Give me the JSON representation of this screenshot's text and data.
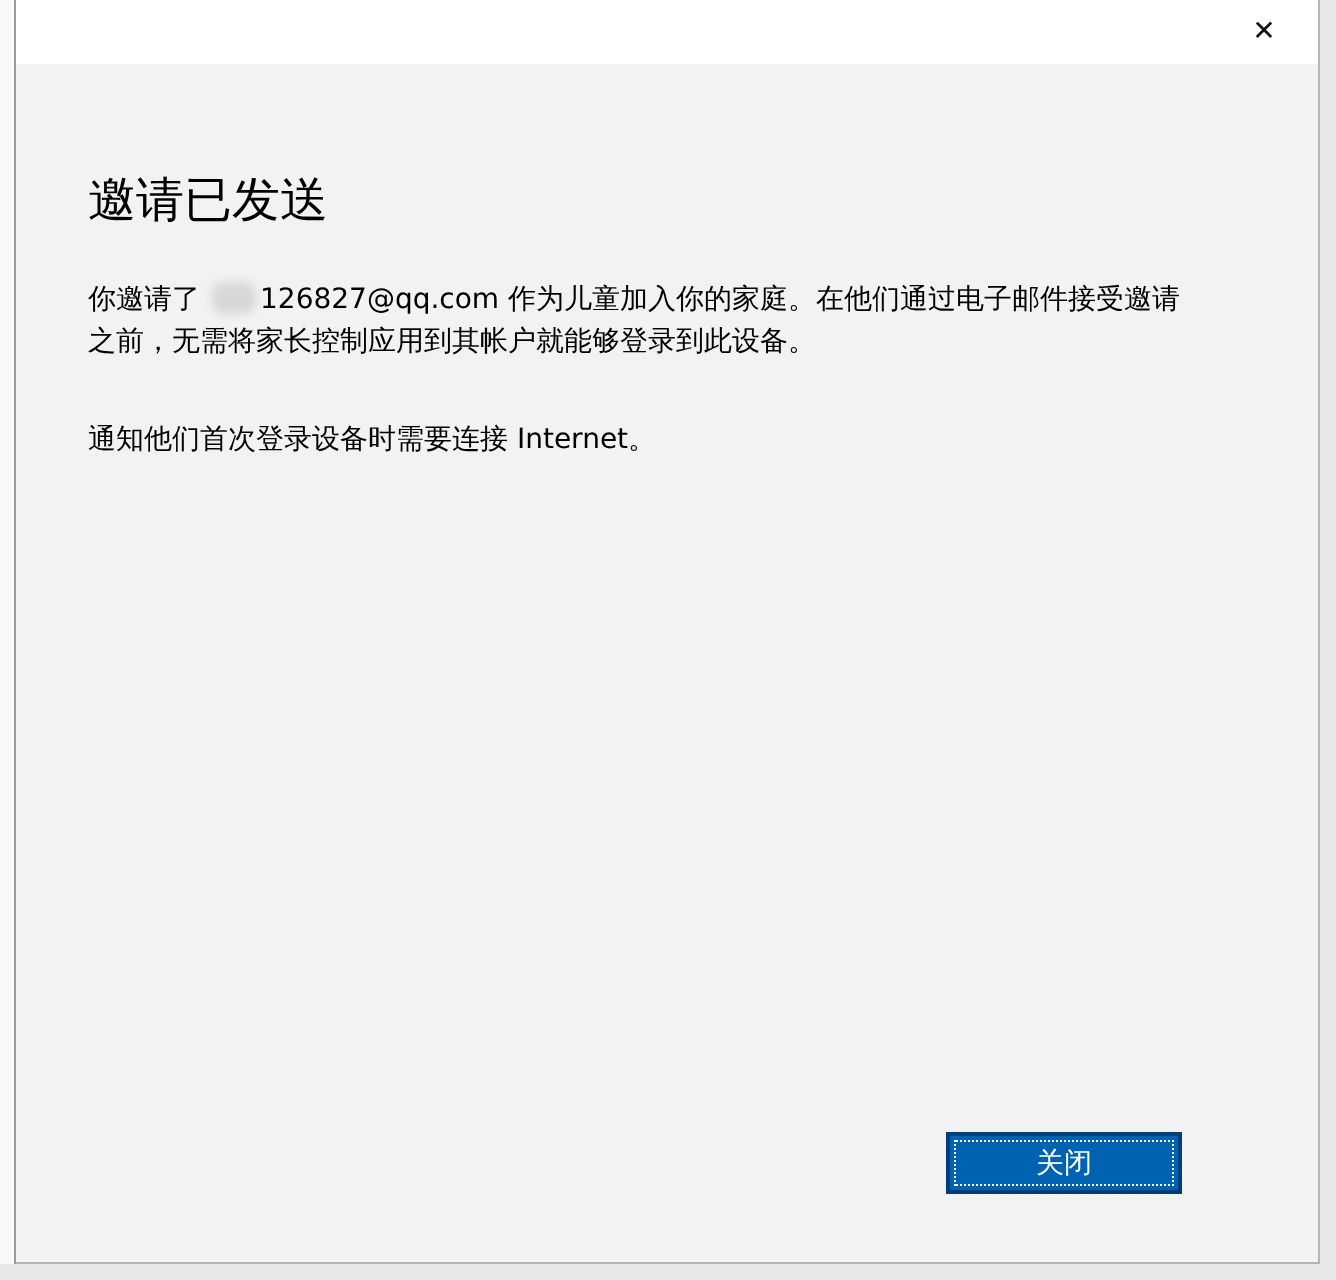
{
  "window": {
    "close_glyph": "✕"
  },
  "title": "邀请已发送",
  "paragraphs": [
    {
      "text": "你邀请了",
      "redacted": true,
      "rest": "126827@qq.com 作为儿童加入你的家庭。在他们通过电子邮件接受邀请之前，无需将家长控制应用到其帐户就能够登录到此设备。"
    },
    {
      "text": "通知他们首次登录设备时需要连接 Internet。",
      "redacted": false
    }
  ],
  "buttons": [
    {
      "label": "关闭",
      "focused": true
    }
  ]
}
